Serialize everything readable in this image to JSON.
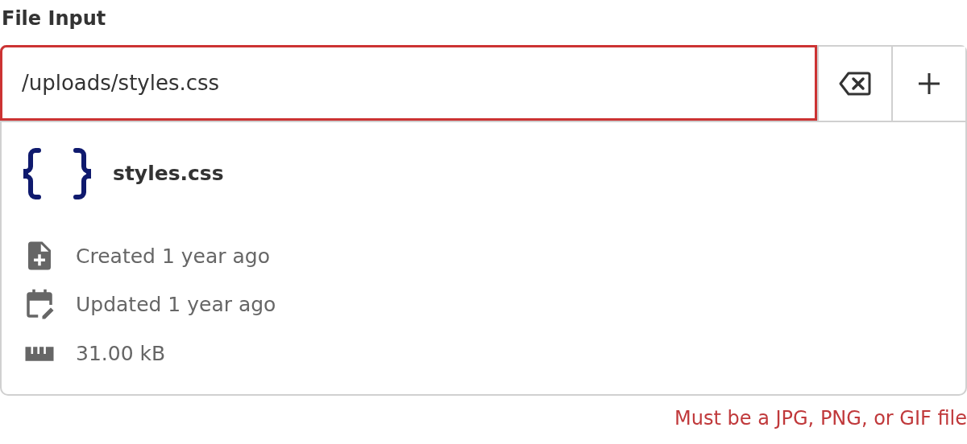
{
  "label": "File Input",
  "field": {
    "value": "/uploads/styles.css",
    "invalid": true
  },
  "file": {
    "name": "styles.css",
    "details": [
      {
        "kind": "created",
        "text": "Created 1 year ago"
      },
      {
        "kind": "updated",
        "text": "Updated 1 year ago"
      },
      {
        "kind": "size",
        "text": "31.00 kB"
      }
    ]
  },
  "error": "Must be a JPG, PNG, or GIF file"
}
